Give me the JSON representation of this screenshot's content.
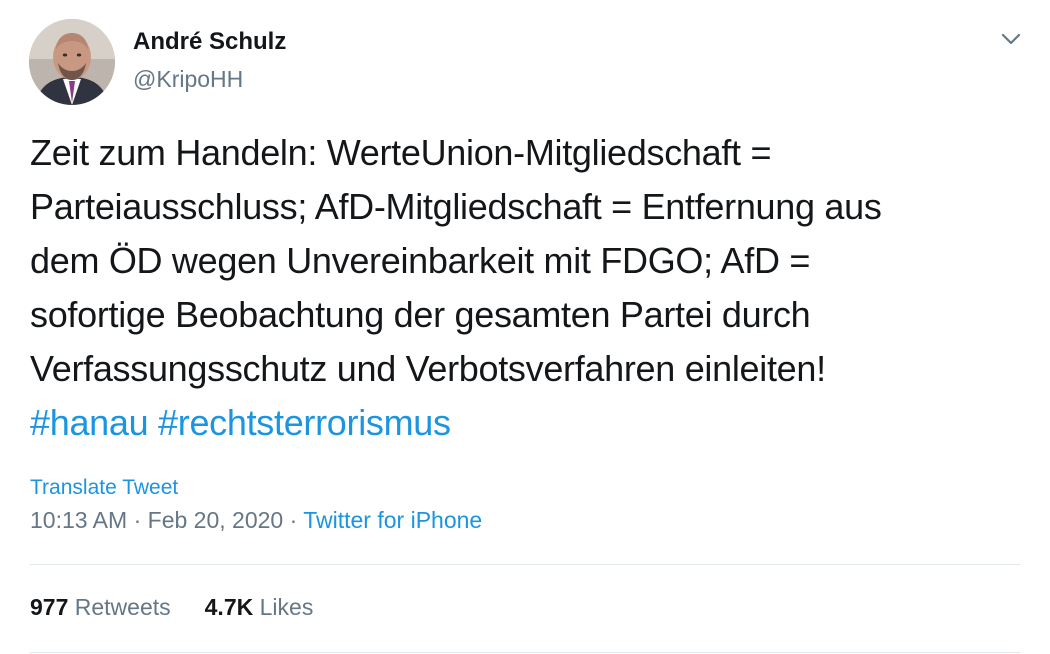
{
  "author": {
    "display_name": "André Schulz",
    "handle": "@KripoHH",
    "avatar_icon": "profile-photo"
  },
  "menu_icon": "chevron-down-icon",
  "tweet": {
    "lines": [
      "Zeit zum Handeln: WerteUnion-Mitgliedschaft =",
      "Parteiausschluss; AfD-Mitgliedschaft = Entfernung aus",
      "dem ÖD wegen Unvereinbarkeit mit FDGO; AfD =",
      "sofortige Beobachtung der gesamten Partei durch",
      "Verfassungsschutz und Verbotsverfahren einleiten!"
    ],
    "hashtags": [
      "#hanau",
      "#rechtsterrorismus"
    ]
  },
  "translate_label": "Translate Tweet",
  "meta": {
    "time": "10:13 AM",
    "separator": " · ",
    "date": "Feb 20, 2020",
    "source": "Twitter for iPhone"
  },
  "stats": {
    "retweets_count": "977",
    "retweets_label": "Retweets",
    "likes_count": "4.7K",
    "likes_label": "Likes"
  },
  "colors": {
    "link": "#1b95e0",
    "text": "#14171a",
    "muted": "#657786",
    "divider": "#e1e8ed"
  }
}
